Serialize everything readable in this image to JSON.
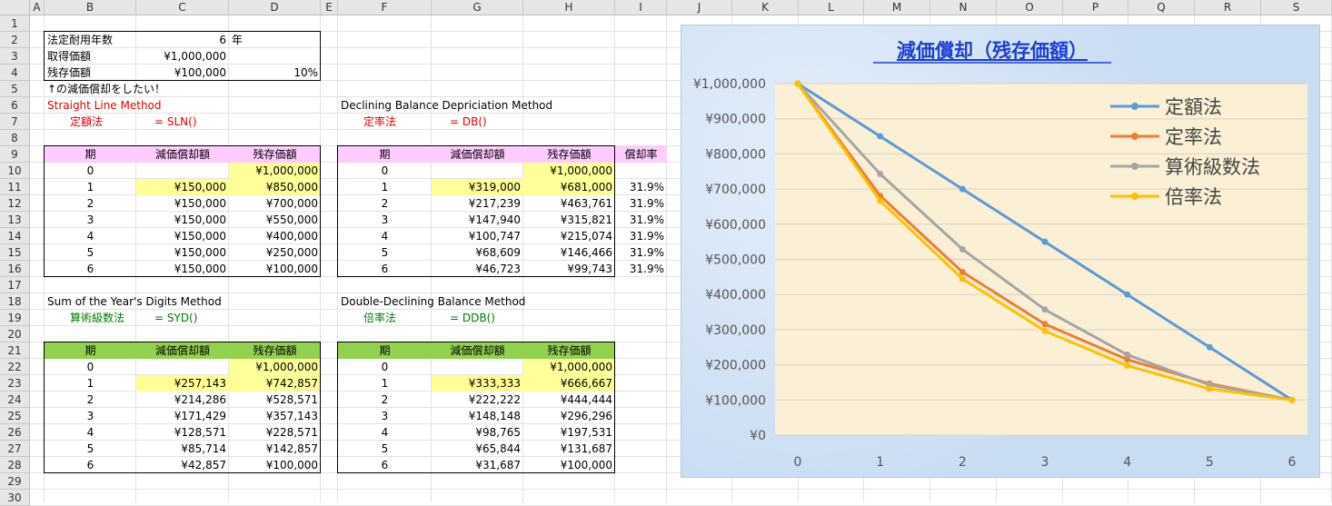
{
  "columns": [
    "A",
    "B",
    "C",
    "D",
    "E",
    "F",
    "G",
    "H",
    "I",
    "J",
    "K",
    "L",
    "M",
    "N",
    "O",
    "P",
    "Q",
    "R",
    "S"
  ],
  "rows": [
    "1",
    "2",
    "3",
    "4",
    "5",
    "6",
    "7",
    "8",
    "9",
    "10",
    "11",
    "12",
    "13",
    "14",
    "15",
    "16",
    "17",
    "18",
    "19",
    "20",
    "21",
    "22",
    "23",
    "24",
    "25",
    "26",
    "27",
    "28",
    "29",
    "30"
  ],
  "params": {
    "life_label": "法定耐用年数",
    "life_value": "6",
    "life_unit": "年",
    "cost_label": "取得価額",
    "cost_value": "¥1,000,000",
    "salvage_label": "残存価額",
    "salvage_value": "¥100,000",
    "salvage_pct": "10%",
    "note": "↑の減価償却をしたい！"
  },
  "sln": {
    "title": "Straight Line Method",
    "name": "定額法",
    "formula": "= SLN()",
    "headers": [
      "期",
      "減価償却額",
      "残存価額"
    ],
    "rows": [
      [
        "0",
        "",
        "¥1,000,000"
      ],
      [
        "1",
        "¥150,000",
        "¥850,000"
      ],
      [
        "2",
        "¥150,000",
        "¥700,000"
      ],
      [
        "3",
        "¥150,000",
        "¥550,000"
      ],
      [
        "4",
        "¥150,000",
        "¥400,000"
      ],
      [
        "5",
        "¥150,000",
        "¥250,000"
      ],
      [
        "6",
        "¥150,000",
        "¥100,000"
      ]
    ]
  },
  "db": {
    "title": "Declining Balance Depriciation Method",
    "name": "定率法",
    "formula": "= DB()",
    "headers": [
      "期",
      "減価償却額",
      "残存価額",
      "償却率"
    ],
    "rows": [
      [
        "0",
        "",
        "¥1,000,000",
        ""
      ],
      [
        "1",
        "¥319,000",
        "¥681,000",
        "31.9%"
      ],
      [
        "2",
        "¥217,239",
        "¥463,761",
        "31.9%"
      ],
      [
        "3",
        "¥147,940",
        "¥315,821",
        "31.9%"
      ],
      [
        "4",
        "¥100,747",
        "¥215,074",
        "31.9%"
      ],
      [
        "5",
        "¥68,609",
        "¥146,466",
        "31.9%"
      ],
      [
        "6",
        "¥46,723",
        "¥99,743",
        "31.9%"
      ]
    ]
  },
  "syd": {
    "title": "Sum of the Year's Digits Method",
    "name": "算術級数法",
    "formula": "= SYD()",
    "headers": [
      "期",
      "減価償却額",
      "残存価額"
    ],
    "rows": [
      [
        "0",
        "",
        "¥1,000,000"
      ],
      [
        "1",
        "¥257,143",
        "¥742,857"
      ],
      [
        "2",
        "¥214,286",
        "¥528,571"
      ],
      [
        "3",
        "¥171,429",
        "¥357,143"
      ],
      [
        "4",
        "¥128,571",
        "¥228,571"
      ],
      [
        "5",
        "¥85,714",
        "¥142,857"
      ],
      [
        "6",
        "¥42,857",
        "¥100,000"
      ]
    ]
  },
  "ddb": {
    "title": "Double-Declining Balance Method",
    "name": "倍率法",
    "formula": "= DDB()",
    "headers": [
      "期",
      "減価償却額",
      "残存価額"
    ],
    "rows": [
      [
        "0",
        "",
        "¥1,000,000"
      ],
      [
        "1",
        "¥333,333",
        "¥666,667"
      ],
      [
        "2",
        "¥222,222",
        "¥444,444"
      ],
      [
        "3",
        "¥148,148",
        "¥296,296"
      ],
      [
        "4",
        "¥98,765",
        "¥197,531"
      ],
      [
        "5",
        "¥65,844",
        "¥131,687"
      ],
      [
        "6",
        "¥31,687",
        "¥100,000"
      ]
    ]
  },
  "colors": {
    "pink_header": "#ffccff",
    "green_header": "#92d050",
    "yellow": "#ffff99",
    "red_text": "#e00000",
    "green_text": "#007a00"
  },
  "chart_data": {
    "type": "line",
    "title": "減価償却（残存価額）",
    "x": [
      0,
      1,
      2,
      3,
      4,
      5,
      6
    ],
    "ylim": [
      0,
      1000000
    ],
    "yticks": [
      "¥0",
      "¥100,000",
      "¥200,000",
      "¥300,000",
      "¥400,000",
      "¥500,000",
      "¥600,000",
      "¥700,000",
      "¥800,000",
      "¥900,000",
      "¥1,000,000"
    ],
    "grid": true,
    "legend": "top-right",
    "series": [
      {
        "name": "定額法",
        "color": "#5b9bd5",
        "values": [
          1000000,
          850000,
          700000,
          550000,
          400000,
          250000,
          100000
        ]
      },
      {
        "name": "定率法",
        "color": "#ed7d31",
        "values": [
          1000000,
          681000,
          463761,
          315821,
          215074,
          146466,
          99743
        ]
      },
      {
        "name": "算術級数法",
        "color": "#a5a5a5",
        "values": [
          1000000,
          742857,
          528571,
          357143,
          228571,
          142857,
          100000
        ]
      },
      {
        "name": "倍率法",
        "color": "#ffc000",
        "values": [
          1000000,
          666667,
          444444,
          296296,
          197531,
          131687,
          100000
        ]
      }
    ]
  }
}
